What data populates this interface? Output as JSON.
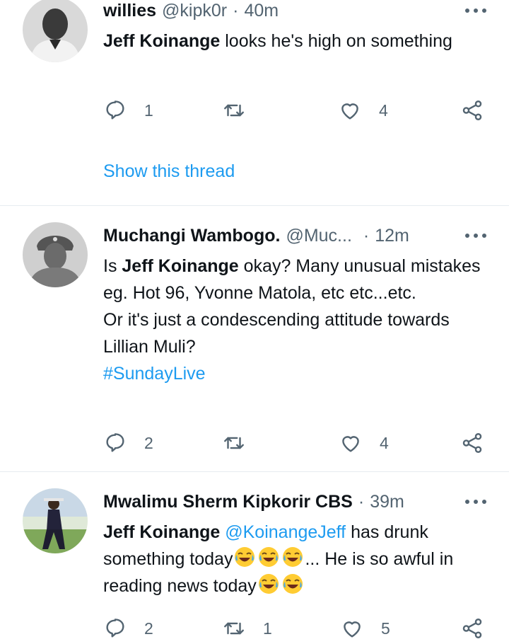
{
  "tweets": [
    {
      "name": "willies",
      "handle": "@kipk0r",
      "sep": "·",
      "time": "40m",
      "text_bold": "Jeff Koinange",
      "text_rest": " looks he's high on something",
      "reply_count": "1",
      "retweet_count": "",
      "like_count": "4",
      "show_thread": "Show this thread"
    },
    {
      "name": "Muchangi Wambogo.",
      "handle": "@Muc...",
      "sep": "·",
      "time": "12m",
      "text_pre": "Is ",
      "text_bold": "Jeff Koinange",
      "text_rest": " okay? Many unusual mistakes eg. Hot 96, Yvonne Matola, etc etc...etc.",
      "text_line2": "Or it's just a condescending attitude towards Lillian Muli?",
      "hashtag": "#SundayLive",
      "reply_count": "2",
      "retweet_count": "",
      "like_count": "4"
    },
    {
      "name": "Mwalimu Sherm Kipkorir CBS",
      "handle": "",
      "sep": "·",
      "time": "39m",
      "text_bold": "Jeff Koinange",
      "mention": "@KoinangeJeff",
      "text_a": " has drunk something today",
      "text_b": "... He is so awful in reading news today",
      "reply_count": "2",
      "retweet_count": "1",
      "like_count": "5"
    }
  ],
  "colors": {
    "accent": "#1d9bf0",
    "muted": "#536471",
    "text": "#0f1419",
    "divider": "#e6ecf0"
  },
  "icons": [
    "reply-icon",
    "retweet-icon",
    "like-icon",
    "share-icon",
    "more-icon",
    "laughing-emoji"
  ]
}
